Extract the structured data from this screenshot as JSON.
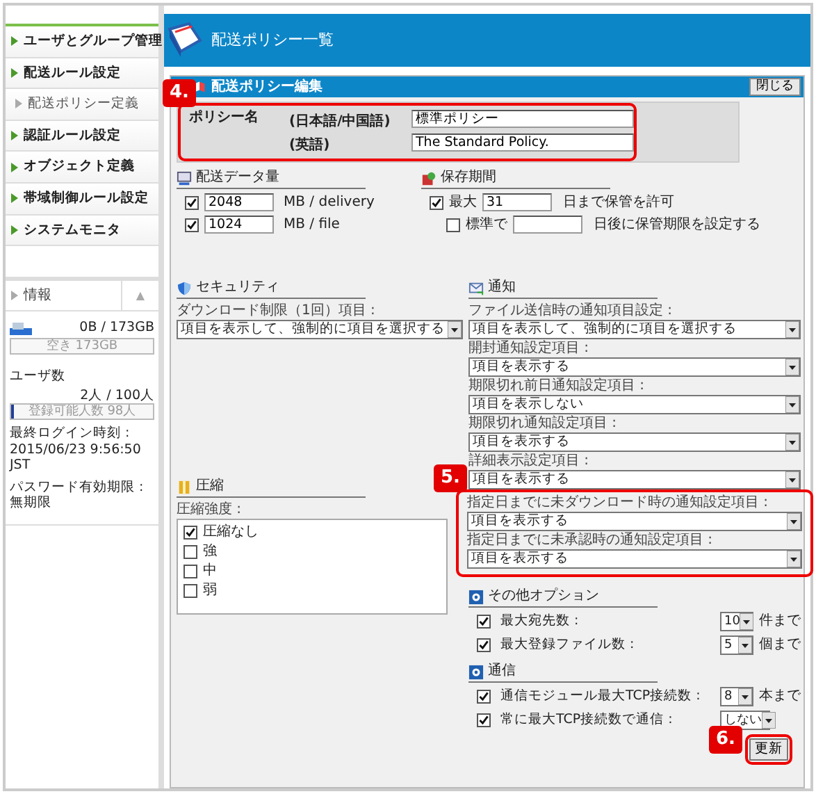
{
  "sidebar": {
    "menu": [
      {
        "label": "ユーザとグループ管理",
        "kind": "main"
      },
      {
        "label": "配送ルール設定",
        "kind": "main"
      },
      {
        "label": "配送ポリシー定義",
        "kind": "sub"
      },
      {
        "label": "認証ルール設定",
        "kind": "main"
      },
      {
        "label": "オブジェクト定義",
        "kind": "main"
      },
      {
        "label": "帯域制御ルール設定",
        "kind": "main"
      },
      {
        "label": "システムモニタ",
        "kind": "main"
      }
    ],
    "info": {
      "title": "情報",
      "toggle": "▲",
      "disk_usage": "0B / 173GB",
      "disk_bar": {
        "text": "空き 173GB",
        "level": 0
      },
      "users_label": "ユーザ数",
      "users_count": "2人 / 100人",
      "users_bar": {
        "text": "登録可能人数 98人",
        "level": 0.02
      },
      "last_login_label": "最終ログイン時刻 :",
      "last_login": "2015/06/23 9:56:50 JST",
      "password_label": "パスワード有効期限 :",
      "password_expiry": "無期限"
    }
  },
  "header": {
    "title": "配送ポリシー一覧"
  },
  "panel": {
    "title": "配送ポリシー編集",
    "close_button": "閉じる",
    "policy_name": {
      "label": "ポリシー名",
      "annotation": "4.",
      "fields": [
        {
          "language": "(日本語/中国語)",
          "value": "標準ポリシー"
        },
        {
          "language": "(英語)",
          "value": "The Standard Policy."
        }
      ]
    },
    "delivery_size": {
      "title": "配送データ量",
      "rows": [
        {
          "checked": true,
          "value": "2048",
          "unit": "MB / delivery"
        },
        {
          "checked": true,
          "value": "1024",
          "unit": "MB / file"
        }
      ]
    },
    "retention": {
      "title": "保存期間",
      "rows": [
        {
          "checked": true,
          "prefix": "最大",
          "value": "31",
          "suffix": "日まで保管を許可"
        },
        {
          "checked": false,
          "prefix": "標準で",
          "suffix": "日後に保管期限を設定する"
        }
      ]
    },
    "security": {
      "title": "セキュリティ",
      "fields": [
        {
          "label": "ダウンロード制限（1回）項目 :",
          "value": "項目を表示して、強制的に項目を選択する"
        }
      ]
    },
    "compression": {
      "title": "圧縮",
      "label": "圧縮強度 :",
      "options": [
        {
          "label": "圧縮なし",
          "checked": true
        },
        {
          "label": "強",
          "checked": false
        },
        {
          "label": "中",
          "checked": false
        },
        {
          "label": "弱",
          "checked": false
        }
      ]
    },
    "notification": {
      "title": "通知",
      "annotation": "5.",
      "fields": [
        {
          "label": "ファイル送信時の通知項目設定 :",
          "value": "項目を表示して、強制的に項目を選択する",
          "highlighted": false
        },
        {
          "label": "開封通知設定項目 :",
          "value": "項目を表示する",
          "highlighted": false
        },
        {
          "label": "期限切れ前日通知設定項目 :",
          "value": "項目を表示しない",
          "highlighted": false
        },
        {
          "label": "期限切れ通知設定項目 :",
          "value": "項目を表示する",
          "highlighted": false
        },
        {
          "label": "詳細表示設定項目 :",
          "value": "項目を表示する",
          "highlighted": false
        },
        {
          "label": "指定日までに未ダウンロード時の通知設定項目 :",
          "value": "項目を表示する",
          "highlighted": true
        },
        {
          "label": "指定日までに未承認時の通知設定項目 :",
          "value": "項目を表示する",
          "highlighted": true
        }
      ]
    },
    "other_options": {
      "title": "その他オプション",
      "rows": [
        {
          "checked": true,
          "label": "最大宛先数 :",
          "value": "10",
          "unit": "件まで"
        },
        {
          "checked": true,
          "label": "最大登録ファイル数 :",
          "value": "5",
          "unit": "個まで"
        }
      ]
    },
    "communication": {
      "title": "通信",
      "rows": [
        {
          "checked": true,
          "label": "通信モジュール最大TCP接続数 :",
          "value": "8",
          "unit": "本まで"
        },
        {
          "checked": true,
          "label": "常に最大TCP接続数で通信 :",
          "value": "しない"
        }
      ]
    },
    "update_button": "更新",
    "update_annotation": "6."
  }
}
